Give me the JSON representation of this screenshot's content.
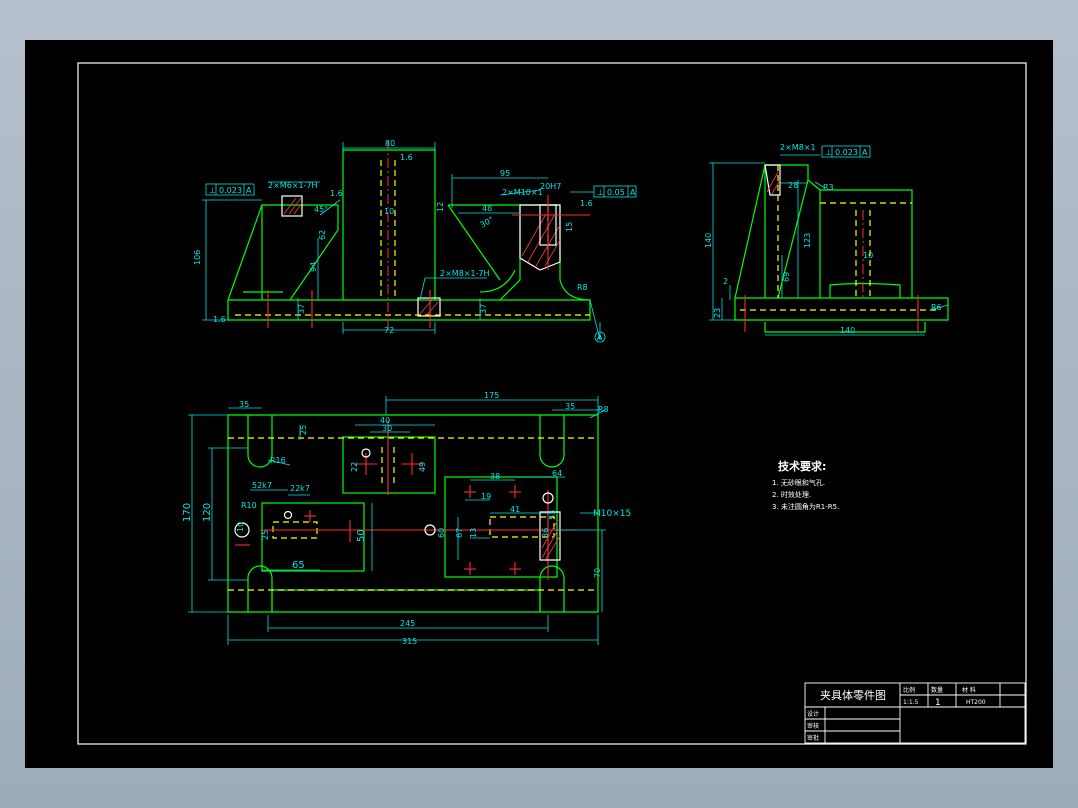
{
  "colors": {
    "background": "#a8b4c2",
    "sheet": "#000000",
    "outline": "#00ff00",
    "dimension": "#00e5e5",
    "border": "#ffffff",
    "hidden": "#ffff00",
    "center": "#ff2a2a"
  },
  "front_view": {
    "dims": {
      "top_width": "80",
      "span_95": "95",
      "height_106": "106",
      "d37a": "37",
      "d37b": "37",
      "d94": "94",
      "d62": "62",
      "d10": "10",
      "d72": "72",
      "d12": "12",
      "d48": "48",
      "d15": "15",
      "d30deg": "30°",
      "d45deg": "45°",
      "r8": "R8",
      "note_tap_left": "2×M6×1-7H",
      "note_tap_right": "2×M10×1",
      "note_fit": "20H7",
      "note_tap_bottom": "2×M8×1-7H",
      "gdt_left_sym": "⊥",
      "gdt_left_val": "0.023",
      "gdt_left_ref": "A",
      "gdt_right_sym": "⊥",
      "gdt_right_val": "0.05",
      "gdt_right_ref": "A",
      "datum": "A",
      "rough1": "1.6",
      "rough2": "1.6",
      "rough3": "1.6",
      "rough4": "1.6"
    }
  },
  "side_view": {
    "dims": {
      "note_tap": "2×M8×1",
      "gdt_sym": "⊥",
      "gdt_val": "0.023",
      "gdt_ref": "A",
      "d28": "28",
      "r3": "R3",
      "d140v": "140",
      "d123": "123",
      "d69": "69",
      "d10": "10",
      "d2": "2",
      "d23": "23",
      "d140h": "140",
      "r6": "R6"
    }
  },
  "top_view": {
    "dims": {
      "d175": "175",
      "d35a": "35",
      "d35b": "35",
      "r8": "R8",
      "d25": "25",
      "d40": "40",
      "d30": "30",
      "r16": "R16",
      "d22": "22",
      "d49": "49",
      "d170": "170",
      "d120": "120",
      "d52k7": "52k7",
      "d22k7": "22k7",
      "r10": "R10",
      "d10": "10",
      "d25b": "25",
      "d50": "50",
      "d65": "65",
      "d60": "60",
      "d38": "38",
      "d64": "64",
      "d19": "19",
      "d41": "41",
      "d67": "67",
      "d13": "13",
      "d53": "53",
      "d36": "36",
      "m10": "M10×15",
      "d70": "70",
      "d245": "245",
      "d315": "315"
    }
  },
  "notes": {
    "heading": "技术要求:",
    "items": [
      "1. 无砂眼和气孔.",
      "2. 时效处理.",
      "3. 未注圆角为R1-R5."
    ]
  },
  "title_block": {
    "drawing_title": "夹具体零件图",
    "col_scale": "比例",
    "col_qty": "数量",
    "col_material": "材 料",
    "scale": "1:1.5",
    "quantity": "1",
    "material": "HT200",
    "row_drawn": "设计",
    "row_checked": "审核",
    "row_approved": "审批"
  }
}
